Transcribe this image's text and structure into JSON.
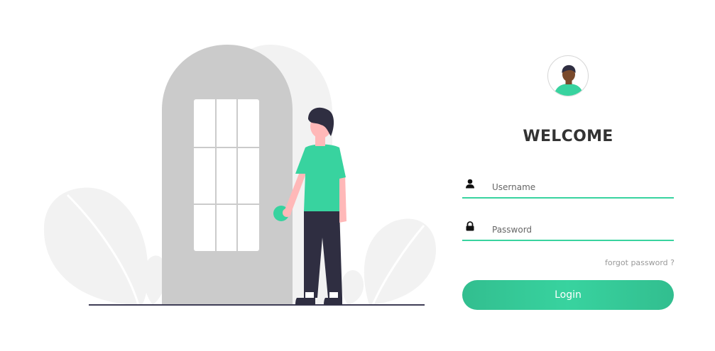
{
  "illustration": {
    "alt": "Person opening a door"
  },
  "login": {
    "avatar_icon": "user-avatar-icon",
    "title": "WELCOME",
    "username": {
      "icon": "user-icon",
      "placeholder": "Username",
      "value": ""
    },
    "password": {
      "icon": "lock-icon",
      "placeholder": "Password",
      "value": ""
    },
    "forgot_label": "forgot password ?",
    "login_label": "Login"
  },
  "colors": {
    "accent": "#38d39f",
    "accent_dark": "#32be8f",
    "title": "#333333",
    "muted": "#999999",
    "shape_gray": "#cbcbcb",
    "shape_light": "#f2f2f2",
    "pants": "#2f2e41",
    "skin": "#ffb8b8"
  }
}
